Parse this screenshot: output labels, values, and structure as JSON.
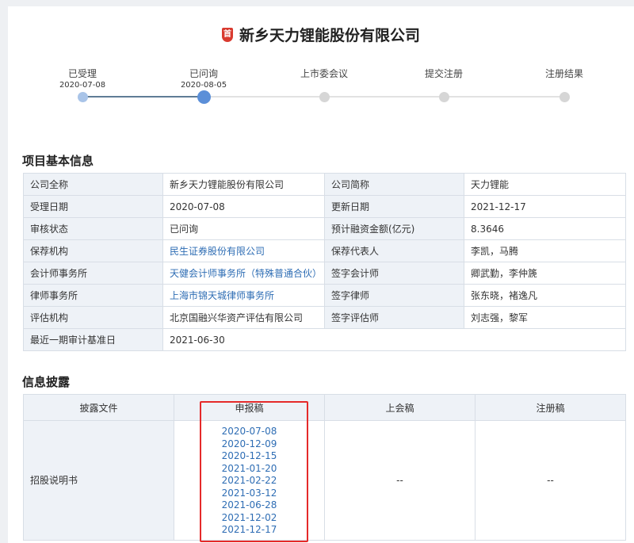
{
  "header": {
    "logo_text": "首",
    "company_title": "新乡天力锂能股份有限公司"
  },
  "progress": {
    "steps": [
      {
        "label": "已受理",
        "date": "2020-07-08",
        "state": "done"
      },
      {
        "label": "已问询",
        "date": "2020-08-05",
        "state": "current"
      },
      {
        "label": "上市委会议",
        "date": "",
        "state": "todo"
      },
      {
        "label": "提交注册",
        "date": "",
        "state": "todo"
      },
      {
        "label": "注册结果",
        "date": "",
        "state": "todo"
      }
    ]
  },
  "basic_info": {
    "section_title": "项目基本信息",
    "rows": [
      [
        {
          "label": "公司全称",
          "value": "新乡天力锂能股份有限公司"
        },
        {
          "label": "公司简称",
          "value": "天力锂能"
        }
      ],
      [
        {
          "label": "受理日期",
          "value": "2020-07-08"
        },
        {
          "label": "更新日期",
          "value": "2021-12-17"
        }
      ],
      [
        {
          "label": "审核状态",
          "value": "已问询"
        },
        {
          "label": "预计融资金额(亿元)",
          "value": "8.3646"
        }
      ],
      [
        {
          "label": "保荐机构",
          "value": "民生证券股份有限公司",
          "link": true
        },
        {
          "label": "保荐代表人",
          "value": "李凯，马腾"
        }
      ],
      [
        {
          "label": "会计师事务所",
          "value": "天健会计师事务所（特殊普通合伙）",
          "link": true
        },
        {
          "label": "签字会计师",
          "value": "卿武勤，李仲篪"
        }
      ],
      [
        {
          "label": "律师事务所",
          "value": "上海市锦天城律师事务所",
          "link": true
        },
        {
          "label": "签字律师",
          "value": "张东晓，褚逸凡"
        }
      ],
      [
        {
          "label": "评估机构",
          "value": "北京国融兴华资产评估有限公司"
        },
        {
          "label": "签字评估师",
          "value": "刘志强，黎军"
        }
      ]
    ],
    "last_row": {
      "label": "最近一期审计基准日",
      "value": "2021-06-30"
    }
  },
  "disclosure": {
    "section_title": "信息披露",
    "headers": [
      "披露文件",
      "申报稿",
      "上会稿",
      "注册稿"
    ],
    "document": "招股说明书",
    "filing_dates": [
      "2020-07-08",
      "2020-12-09",
      "2020-12-15",
      "2021-01-20",
      "2021-02-22",
      "2021-03-12",
      "2021-06-28",
      "2021-12-02",
      "2021-12-17"
    ],
    "meeting_draft": "--",
    "registration_draft": "--"
  },
  "colors": {
    "highlight": "#e52a2a",
    "link": "#2e6db4",
    "label_bg": "#eef2f7"
  }
}
